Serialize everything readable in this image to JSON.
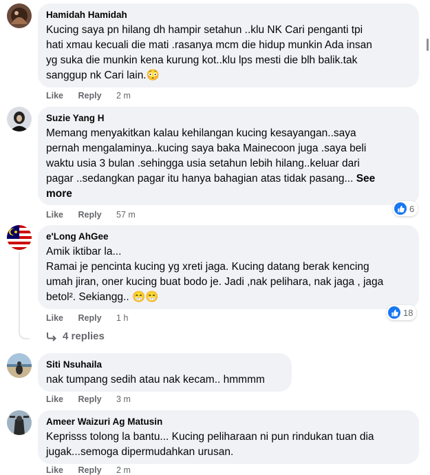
{
  "comments": [
    {
      "author": "Hamidah Hamidah",
      "text": "Kucing saya pn hilang dh hampir setahun ..klu NK Cari penganti tpi\nhati xmau kecuali die mati .rasanya mcm die hidup munkin Ada insan\nyg suka die munkin kena kurung kot..klu lps mesti die blh balik.tak\nsanggup nk Cari lain.😳",
      "like": "Like",
      "reply": "Reply",
      "time": "2 m"
    },
    {
      "author": "Suzie Yang H",
      "text": "Memang menyakitkan kalau kehilangan kucing kesayangan..saya\npernah mengalaminya..kucing saya baka Mainecoon juga .saya beli\nwaktu usia 3 bulan .sehingga usia setahun lebih hilang..keluar dari\npagar ..sedangkan pagar itu hanya bahagian atas tidak pasang... ",
      "see_more": "See\nmore",
      "like": "Like",
      "reply": "Reply",
      "time": "57 m",
      "reactions": "6"
    },
    {
      "author": "e'Long AhGee",
      "text": "Amik iktibar la...\nRamai je pencinta kucing yg xreti jaga. Kucing datang berak kencing\numah jiran, oner kucing buat bodo je. Jadi ,nak pelihara, nak jaga , jaga\nbetol². Sekiangg.. 😁😁",
      "like": "Like",
      "reply": "Reply",
      "time": "1 h",
      "reactions": "18",
      "replies": "4 replies"
    },
    {
      "author": "Siti Nsuhaila",
      "text": "nak tumpang sedih atau nak kecam.. hmmmm",
      "like": "Like",
      "reply": "Reply",
      "time": "3 m"
    },
    {
      "author": "Ameer Waizuri Ag Matusin",
      "text": "Keprisss tolong la bantu... Kucing peliharaan ni pun rindukan tuan dia\njugak...semoga dipermudahkan urusan.",
      "like": "Like",
      "reply": "Reply",
      "time": "2 m"
    }
  ],
  "icons": {
    "like_reaction": "thumbs-up-icon",
    "reply_arrow": "reply-arrow-icon"
  },
  "colors": {
    "bubble": "#f0f2f5",
    "meta": "#65676b",
    "like_blue": "#1877f2"
  }
}
